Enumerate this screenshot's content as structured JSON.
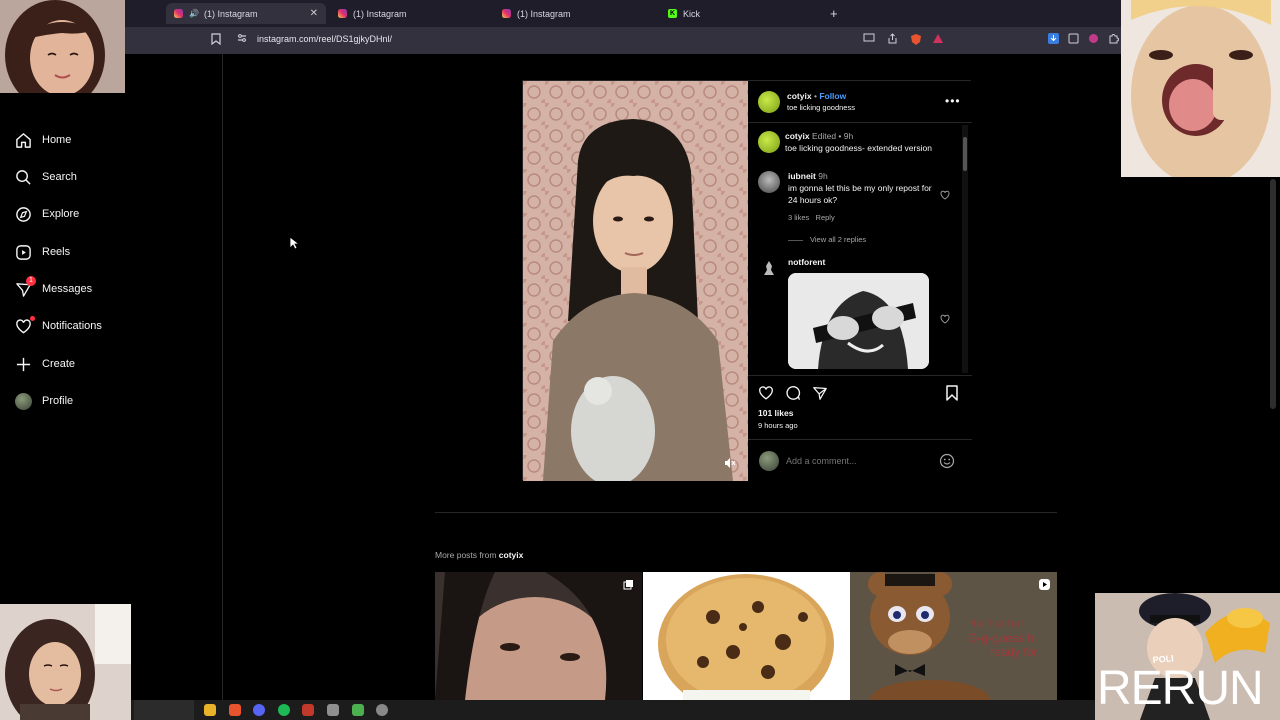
{
  "browser": {
    "tabs": [
      {
        "title": "(1) Instagram",
        "active": true
      },
      {
        "title": "(1) Instagram",
        "active": false
      },
      {
        "title": "(1) Instagram",
        "active": false
      },
      {
        "title": "Kick",
        "active": false
      }
    ],
    "new_tab": "+",
    "url": "instagram.com/reel/DS1gjkyDHnl/"
  },
  "sidebar": {
    "items": [
      {
        "label": "Home",
        "icon": "home-icon"
      },
      {
        "label": "Search",
        "icon": "search-icon"
      },
      {
        "label": "Explore",
        "icon": "compass-icon"
      },
      {
        "label": "Reels",
        "icon": "reels-icon"
      },
      {
        "label": "Messages",
        "icon": "messenger-icon",
        "badge": "1"
      },
      {
        "label": "Notifications",
        "icon": "heart-icon"
      },
      {
        "label": "Create",
        "icon": "plus-icon"
      },
      {
        "label": "Profile",
        "icon": "avatar"
      }
    ]
  },
  "post": {
    "username": "cotyix",
    "separator": "•",
    "follow": "Follow",
    "audio": "toe licking goodness",
    "caption": {
      "username": "cotyix",
      "meta": "Edited • 9h",
      "text": "toe licking goodness- extended version"
    },
    "comments": [
      {
        "username": "iubneit",
        "time": "9h",
        "text": "im gonna let this be my only repost for 24 hours ok?",
        "likes": "3 likes",
        "reply": "Reply",
        "view_replies": "View all 2 replies"
      },
      {
        "username": "notforent",
        "time": "",
        "text": ""
      }
    ],
    "likes": "101 likes",
    "time_ago": "9 hours ago",
    "comment_placeholder": "Add a comment..."
  },
  "more_posts": {
    "label": "More posts from",
    "username": "cotyix"
  },
  "overlay": {
    "rerun": "RERUN"
  },
  "colors": {
    "follow": "#4a9eff",
    "badge": "#ff3040",
    "chrome": "#34313f"
  }
}
